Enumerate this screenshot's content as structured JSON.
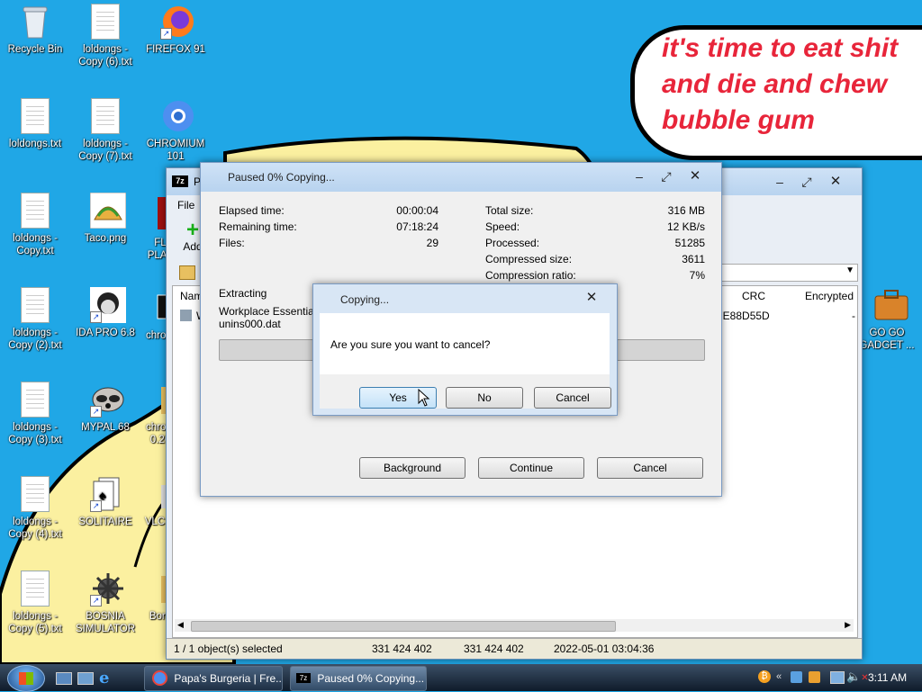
{
  "desktop": {
    "speech_text": "it's time to eat shit\nand die and chew\nbubble gum",
    "icons": [
      {
        "label": "Recycle Bin"
      },
      {
        "label": "loldongs - Copy (6).txt"
      },
      {
        "label": "FIREFOX 91"
      },
      {
        "label": "loldongs.txt"
      },
      {
        "label": "loldongs - Copy (7).txt"
      },
      {
        "label": "CHROMIUM 101"
      },
      {
        "label": "loldongs - Copy.txt"
      },
      {
        "label": "Taco.png"
      },
      {
        "label": "FL PLAY"
      },
      {
        "label": "loldongs - Copy (2).txt"
      },
      {
        "label": "IDA PRO 6.8"
      },
      {
        "label": "chrom"
      },
      {
        "label": "loldongs - Copy (3).txt"
      },
      {
        "label": "MYPAL 68"
      },
      {
        "label": "chrom 0.26"
      },
      {
        "label": "loldongs - Copy (4).txt"
      },
      {
        "label": "SOLITAIRE"
      },
      {
        "label": "VLC pl"
      },
      {
        "label": "loldongs - Copy (5).txt"
      },
      {
        "label": "BOSNIA SIMULATOR"
      },
      {
        "label": "Bord"
      },
      {
        "label": "GO GO GADGET ..."
      }
    ]
  },
  "zip_window": {
    "title": "Pa",
    "menu_file": "File",
    "toolbar_add": "Add",
    "columns": {
      "name": "Name",
      "crc": "CRC",
      "encrypted": "Encrypted"
    },
    "row": {
      "name": "Wo",
      "crc": "7E88D55D",
      "encrypted": "-"
    },
    "status": {
      "selected": "1 / 1 object(s) selected",
      "size": "331 424 402",
      "packed": "331 424 402",
      "modified": "2022-05-01 03:04:36"
    }
  },
  "progress": {
    "title": "Paused 0% Copying...",
    "elapsed_label": "Elapsed time:",
    "elapsed": "00:00:04",
    "remaining_label": "Remaining time:",
    "remaining": "07:18:24",
    "files_label": "Files:",
    "files": "29",
    "total_label": "Total size:",
    "total": "316 MB",
    "speed_label": "Speed:",
    "speed": "12 KB/s",
    "processed_label": "Processed:",
    "processed": "51285",
    "compressed_label": "Compressed size:",
    "compressed": "3611",
    "ratio_label": "Compression ratio:",
    "ratio": "7%",
    "operation": "Extracting",
    "path": "Workplace Essentials",
    "file": "unins000.dat",
    "percent": 0,
    "buttons": {
      "background": "Background",
      "continue": "Continue",
      "cancel": "Cancel"
    }
  },
  "confirm": {
    "title": "Copying...",
    "message": "Are you sure you want to cancel?",
    "yes": "Yes",
    "no": "No",
    "cancel": "Cancel"
  },
  "taskbar": {
    "items": [
      {
        "label": "Papa's Burgeria | Fre..."
      },
      {
        "label": "Paused 0% Copying..."
      }
    ],
    "clock": "3:11 AM"
  },
  "colors": {
    "desktop": "#20a7e6",
    "speech_text": "#e8253a",
    "wallpaper_yellow": "#fbf0a0"
  }
}
